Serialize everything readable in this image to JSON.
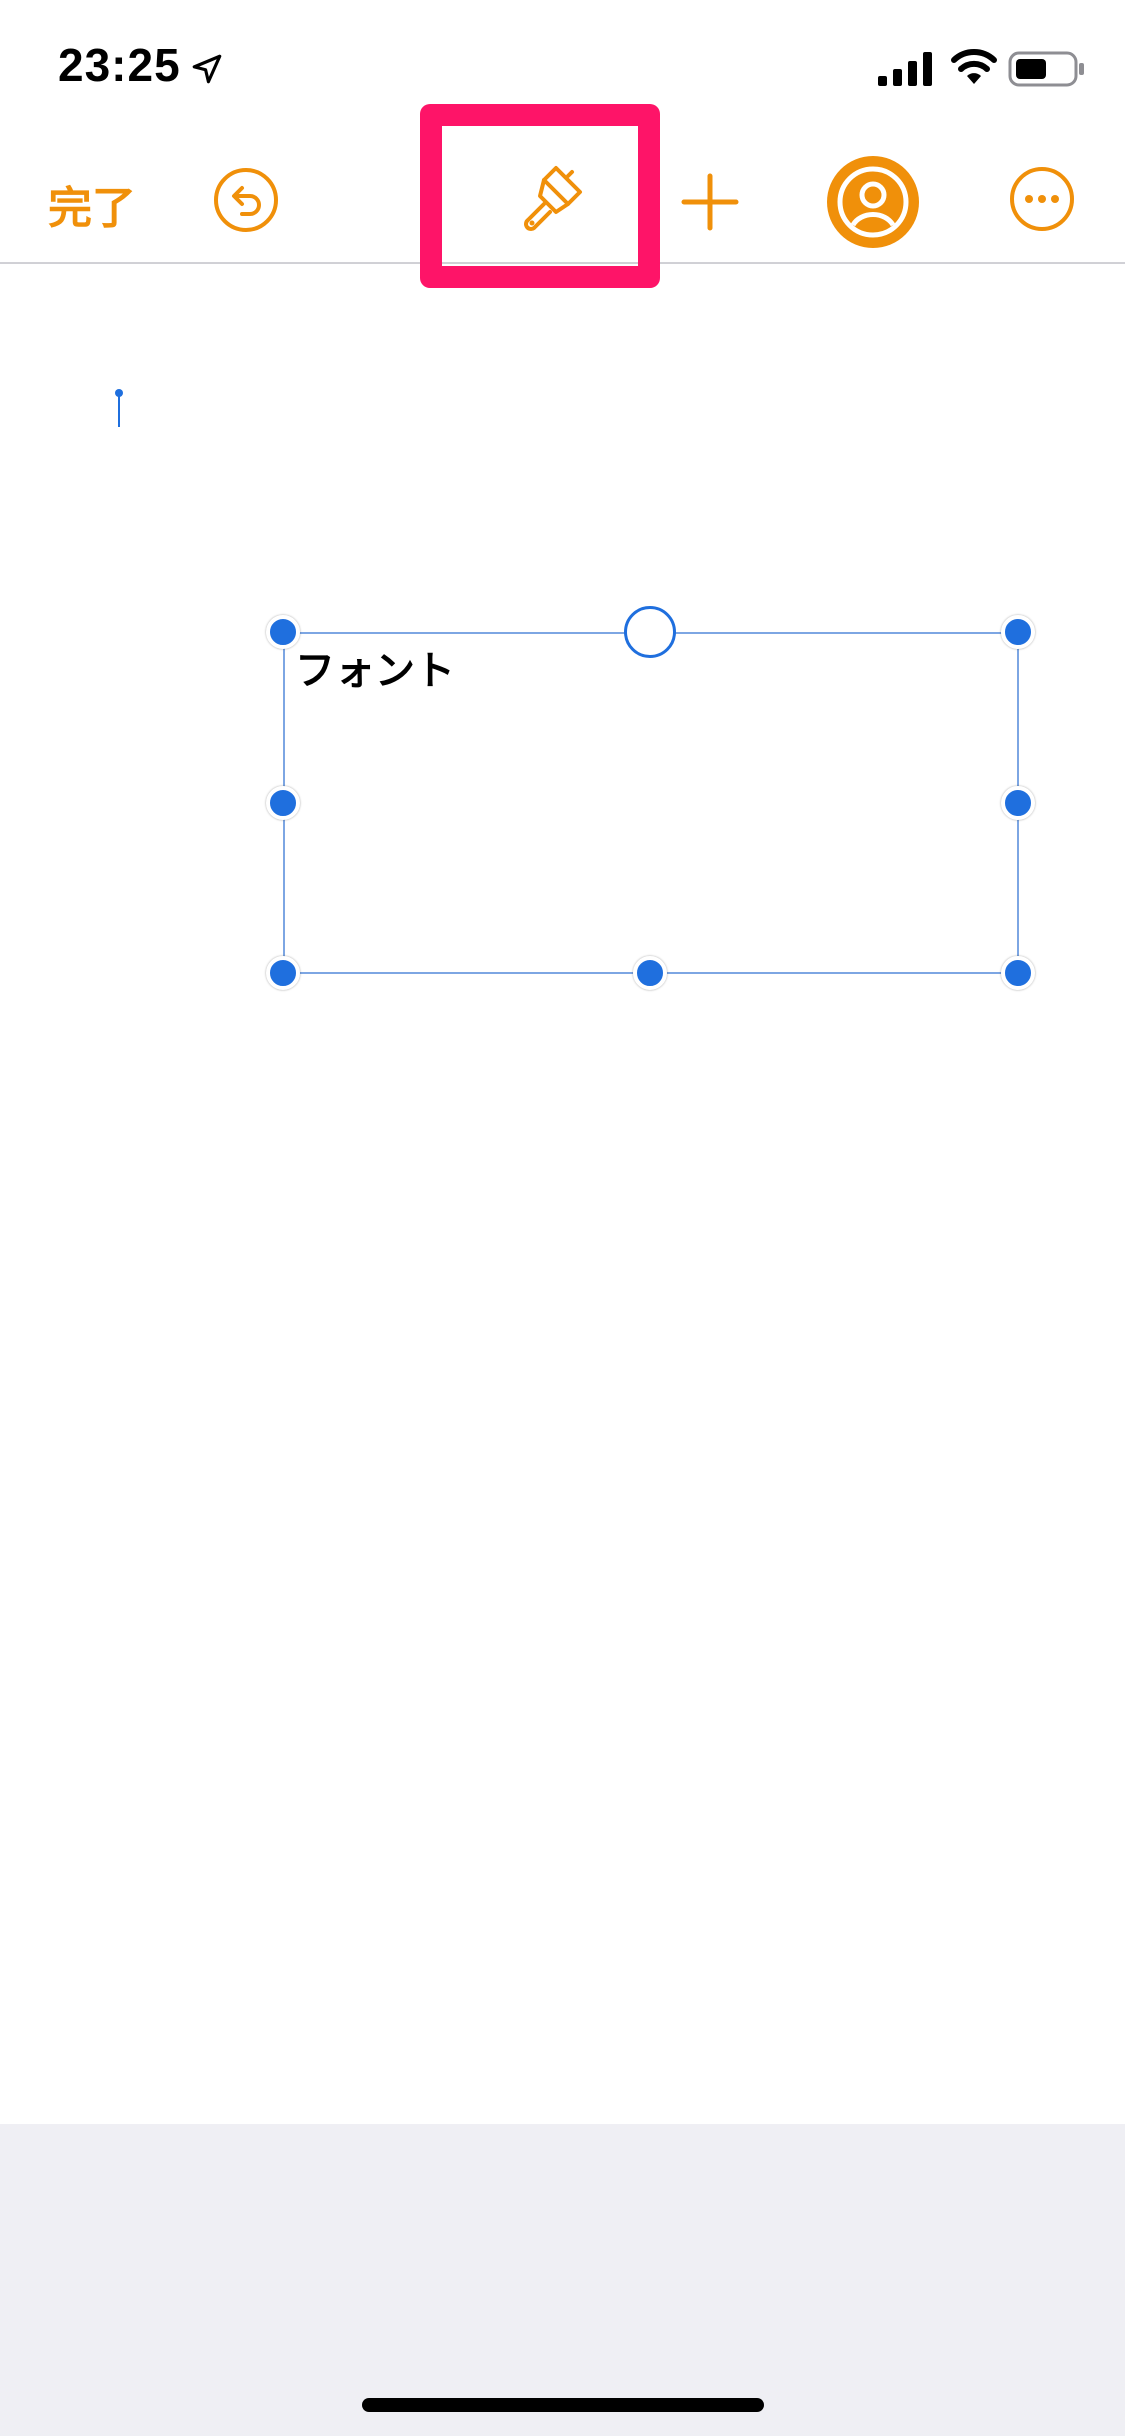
{
  "status_bar": {
    "time": "23:25",
    "icons": [
      "location-arrow-icon",
      "cellular-signal-icon",
      "wifi-icon",
      "battery-icon"
    ]
  },
  "toolbar": {
    "done_label": "完了",
    "icons": [
      "undo-icon",
      "paintbrush-icon",
      "plus-icon",
      "collaborate-person-icon",
      "more-ellipsis-icon"
    ],
    "accent_color": "#f0900a"
  },
  "annotation": {
    "highlight_color": "#fe1468",
    "highlighted": "format-button"
  },
  "document": {
    "text_box": {
      "text": "フォント",
      "selected": true
    },
    "selection_color": "#1f6fde"
  }
}
